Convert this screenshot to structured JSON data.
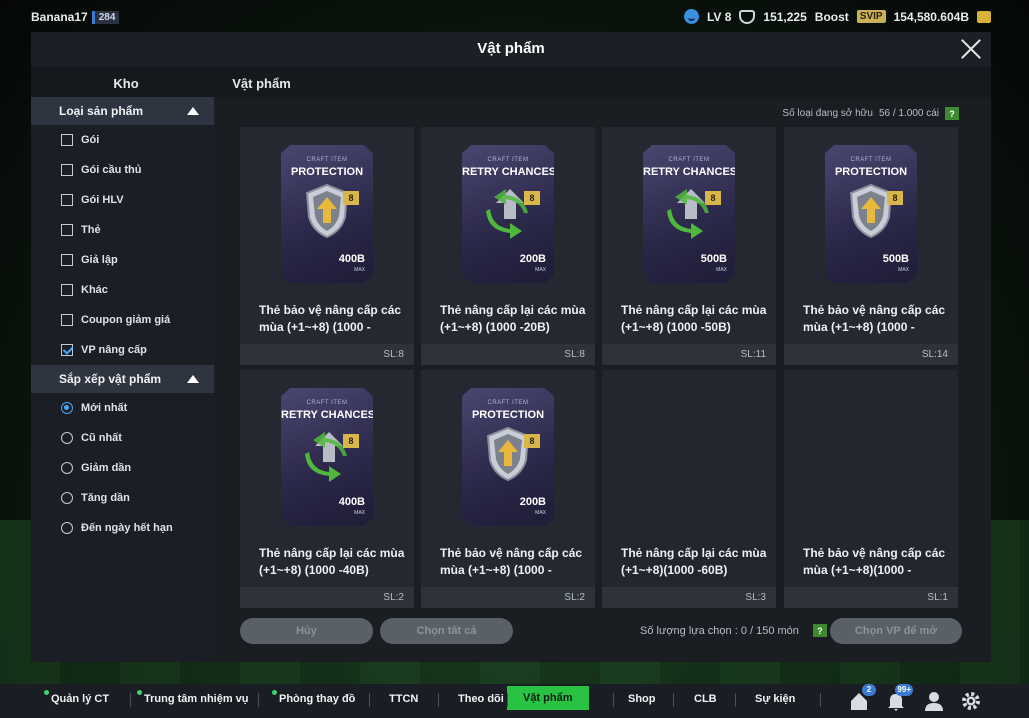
{
  "topbar": {
    "username": "Banana17",
    "user_level_badge": "284",
    "lv": "LV 8",
    "coins": "151,225",
    "boost_label": "Boost",
    "svip": "SVIP",
    "bp": "154,580.604B"
  },
  "modal": {
    "title": "Vật phẩm",
    "tabs": [
      {
        "label": "Kho"
      },
      {
        "label": "Vật phẩm"
      }
    ]
  },
  "sidebar": {
    "filter_title": "Loại sản phẩm",
    "filters": [
      {
        "label": "Gói",
        "checked": false
      },
      {
        "label": "Gói cầu thủ",
        "checked": false
      },
      {
        "label": "Gói HLV",
        "checked": false
      },
      {
        "label": "Thẻ",
        "checked": false
      },
      {
        "label": "Giả lập",
        "checked": false
      },
      {
        "label": "Khác",
        "checked": false
      },
      {
        "label": "Coupon giảm giá",
        "checked": false
      },
      {
        "label": "VP nâng cấp",
        "checked": true
      }
    ],
    "sort_title": "Sắp xếp vật phẩm",
    "sorts": [
      {
        "label": "Mới nhất",
        "selected": true
      },
      {
        "label": "Cũ nhất",
        "selected": false
      },
      {
        "label": "Giảm dần",
        "selected": false
      },
      {
        "label": "Tăng dần",
        "selected": false
      },
      {
        "label": "Đến ngày hết hạn",
        "selected": false
      }
    ]
  },
  "content": {
    "owned_label": "Số loại đang sở hữu",
    "owned_value": "56 / 1.000 cái",
    "help": "?",
    "items": [
      {
        "card": "PROTECTION",
        "caption": "CRAFT ITEM",
        "type": "protection",
        "level": "8",
        "value": "400B",
        "max": "MAX",
        "name": "Thẻ bảo vệ nâng cấp các mùa (+1~+8) (1000 -",
        "sl": "SL:8"
      },
      {
        "card": "RETRY CHANCES",
        "caption": "CRAFT ITEM",
        "type": "retry",
        "level": "8",
        "value": "200B",
        "max": "MAX",
        "name": "Thẻ nâng cấp lại các mùa (+1~+8) (1000 -20B)",
        "sl": "SL:8"
      },
      {
        "card": "RETRY CHANCES",
        "caption": "CRAFT ITEM",
        "type": "retry",
        "level": "8",
        "value": "500B",
        "max": "MAX",
        "name": "Thẻ nâng cấp lại các mùa (+1~+8) (1000 -50B)",
        "sl": "SL:11"
      },
      {
        "card": "PROTECTION",
        "caption": "CRAFT ITEM",
        "type": "protection",
        "level": "8",
        "value": "500B",
        "max": "MAX",
        "name": "Thẻ bảo vệ nâng cấp các mùa (+1~+8) (1000 -",
        "sl": "SL:14"
      },
      {
        "card": "RETRY CHANCES",
        "caption": "CRAFT ITEM",
        "type": "retry",
        "level": "8",
        "value": "400B",
        "max": "MAX",
        "name": "Thẻ nâng cấp lại các mùa (+1~+8) (1000 -40B)",
        "sl": "SL:2"
      },
      {
        "card": "PROTECTION",
        "caption": "CRAFT ITEM",
        "type": "protection",
        "level": "8",
        "value": "200B",
        "max": "MAX",
        "name": "Thẻ bảo vệ nâng cấp các mùa (+1~+8) (1000 -",
        "sl": "SL:2"
      },
      {
        "card": "",
        "caption": "",
        "type": "empty",
        "level": "",
        "value": "",
        "max": "",
        "name": "Thẻ nâng cấp lại các mùa (+1~+8)(1000 -60B)",
        "sl": "SL:3"
      },
      {
        "card": "",
        "caption": "",
        "type": "empty",
        "level": "",
        "value": "",
        "max": "",
        "name": "Thẻ bảo vệ nâng cấp các mùa (+1~+8)(1000 -",
        "sl": "SL:1"
      }
    ],
    "footer": {
      "cancel": "Hủy",
      "select_all": "Chọn tất cả",
      "selected_count": "Số lượng lựa chọn : 0 / 150 món",
      "help": "?",
      "open": "Chọn VP để mở"
    }
  },
  "bottomnav": {
    "items": [
      {
        "label": "Quản lý CT",
        "dot": true
      },
      {
        "label": "Trung tâm nhiệm vụ",
        "dot": true
      },
      {
        "label": "Phòng thay đồ",
        "dot": true
      },
      {
        "label": "TTCN",
        "dot": false
      },
      {
        "label": "Theo dõi",
        "dot": false
      },
      {
        "label": "Vật phẩm",
        "dot": false,
        "active": true
      },
      {
        "label": "Shop",
        "dot": false
      },
      {
        "label": "CLB",
        "dot": false
      },
      {
        "label": "Sự kiện",
        "dot": false
      }
    ],
    "home_badge": "2",
    "bell_badge": "99+"
  },
  "colors": {
    "accent_green": "#29c242",
    "accent_blue": "#4aa8ff",
    "card_purple": "#2a2748"
  }
}
